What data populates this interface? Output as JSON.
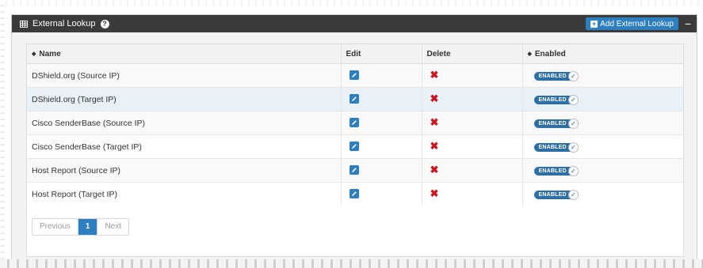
{
  "panel": {
    "title": "External Lookup",
    "help": "?",
    "add_button_label": "Add External Lookup",
    "collapse_symbol": "−"
  },
  "table": {
    "columns": [
      "Name",
      "Edit",
      "Delete",
      "Enabled"
    ],
    "rows": [
      {
        "name": "DShield.org (Source IP)",
        "enabled_label": "ENABLED"
      },
      {
        "name": "DShield.org (Target IP)",
        "enabled_label": "ENABLED"
      },
      {
        "name": "Cisco SenderBase (Source IP)",
        "enabled_label": "ENABLED"
      },
      {
        "name": "Cisco SenderBase (Target IP)",
        "enabled_label": "ENABLED"
      },
      {
        "name": "Host Report (Source IP)",
        "enabled_label": "ENABLED"
      },
      {
        "name": "Host Report (Target IP)",
        "enabled_label": "ENABLED"
      }
    ]
  },
  "pagination": {
    "previous": "Previous",
    "current": "1",
    "next": "Next"
  },
  "icons": {
    "grid": "table-grid-icon",
    "help": "question-circle-icon",
    "add": "plus-square-icon",
    "edit": "pencil-square-icon",
    "delete": "x-icon",
    "toggle_check": "check-icon",
    "sort": "sort-icon"
  },
  "colors": {
    "header_bg": "#3b3b3b",
    "accent": "#2d7fc0",
    "delete": "#c9151e",
    "toggle": "#2d6ea4"
  }
}
